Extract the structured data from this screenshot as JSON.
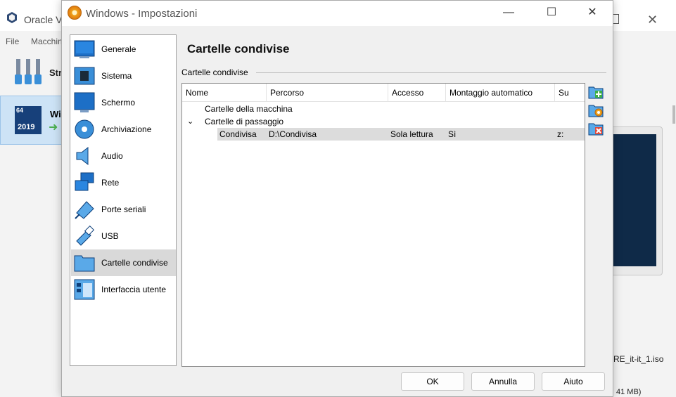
{
  "background_window": {
    "title": "Oracle V",
    "menu": [
      "File",
      "Macchin"
    ],
    "tools_label": "Str",
    "vm_label": "Wi",
    "vm_badge_bits": "64",
    "vm_badge_year": "2019",
    "iso_text": "RE_it-it_1.iso",
    "iso_size": "41 MB)"
  },
  "dialog": {
    "title": "Windows - Impostazioni",
    "section_title": "Cartelle condivise",
    "group_label": "Cartelle condivise",
    "nav_items": [
      {
        "label": "Generale",
        "icon": "monitor-icon"
      },
      {
        "label": "Sistema",
        "icon": "chip-icon"
      },
      {
        "label": "Schermo",
        "icon": "display-icon"
      },
      {
        "label": "Archiviazione",
        "icon": "disk-icon"
      },
      {
        "label": "Audio",
        "icon": "speaker-icon"
      },
      {
        "label": "Rete",
        "icon": "network-icon"
      },
      {
        "label": "Porte seriali",
        "icon": "serial-port-icon"
      },
      {
        "label": "USB",
        "icon": "usb-icon"
      },
      {
        "label": "Cartelle condivise",
        "icon": "folder-icon",
        "selected": true
      },
      {
        "label": "Interfaccia utente",
        "icon": "ui-layout-icon"
      }
    ],
    "table": {
      "columns": [
        "Nome",
        "Percorso",
        "Accesso",
        "Montaggio automatico",
        "Su"
      ],
      "groups": [
        {
          "label": "Cartelle della macchina"
        },
        {
          "label": "Cartelle di passaggio",
          "expanded": true
        }
      ],
      "rows": [
        {
          "nome": "Condivisa",
          "percorso": "D:\\Condivisa",
          "accesso": "Sola lettura",
          "montaggio": "Sì",
          "su": "z:"
        }
      ]
    },
    "side_buttons": [
      "add-shared-folder-icon",
      "edit-shared-folder-icon",
      "remove-shared-folder-icon"
    ],
    "buttons": {
      "ok": "OK",
      "cancel": "Annulla",
      "help": "Aiuto"
    }
  }
}
